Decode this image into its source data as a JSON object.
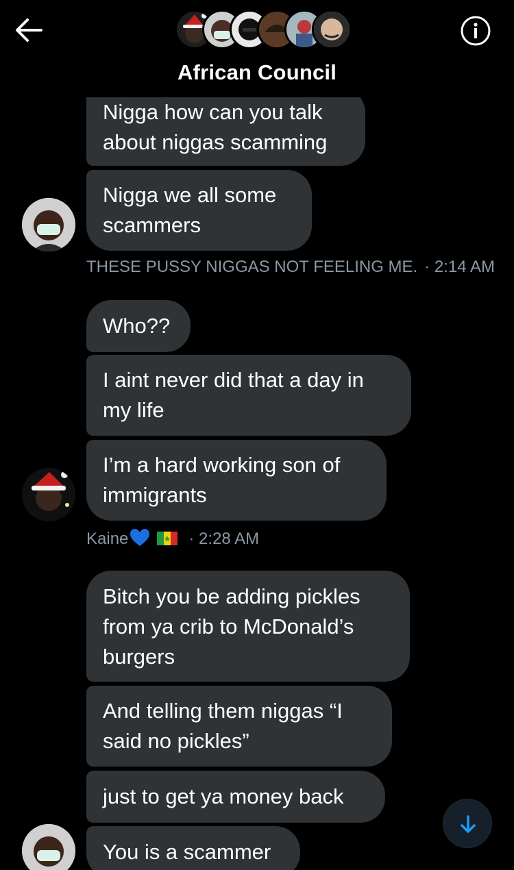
{
  "header": {
    "title": "African Council"
  },
  "messages": [
    {
      "text": "Nigga how can you talk\nabout niggas scamming"
    },
    {
      "text": "Nigga we all some\nscammers"
    },
    {
      "meta_name": "THESE PUSSY NIGGAS NOT FEELING ME.",
      "meta_time": "· 2:14 AM"
    },
    {
      "text": "Who??"
    },
    {
      "text": "I aint never did that a day in\nmy life"
    },
    {
      "text": "I’m a hard working son of\nimmigrants"
    },
    {
      "meta_name": "Kaine",
      "meta_time": "· 2:28 AM"
    },
    {
      "text": "Bitch you be adding pickles\nfrom ya crib to McDonald’s\nburgers"
    },
    {
      "text": "And telling them niggas “I\nsaid no pickles”"
    },
    {
      "text": "just to get ya money back"
    },
    {
      "text": "You is a scammer"
    }
  ],
  "icons": {
    "back": "arrow-left-icon",
    "info": "info-icon",
    "scroll_down": "arrow-down-icon",
    "heart": "blue-heart-emoji",
    "flag": "senegal-flag-emoji"
  },
  "colors": {
    "background": "#000000",
    "bubble": "#2f3336",
    "meta_text": "#8b98a5",
    "accent": "#1d9bf0"
  }
}
